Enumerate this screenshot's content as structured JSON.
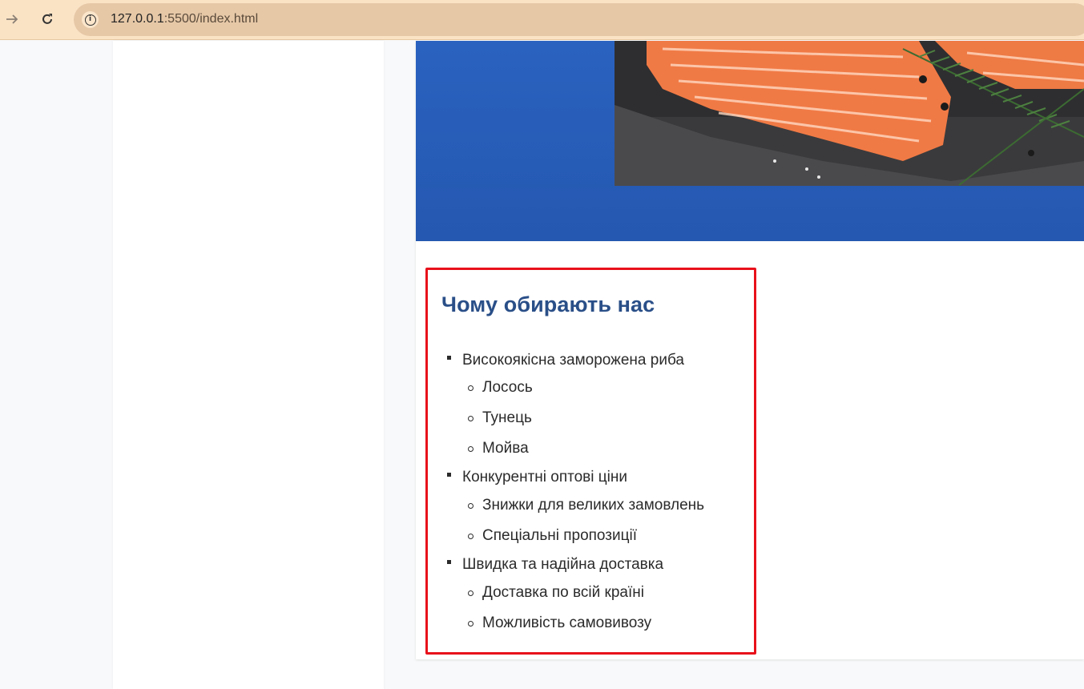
{
  "browser": {
    "url_host": "127.0.0.1",
    "url_rest": ":5500/index.html",
    "forward_icon": "arrow-right-icon",
    "reload_icon": "reload-icon",
    "info_icon": "info-icon"
  },
  "hero": {
    "image": "salmon-fillet-photo"
  },
  "features": {
    "title": "Чому обирають нас",
    "items": [
      {
        "label": "Високоякісна заморожена риба",
        "sub": [
          "Лосось",
          "Тунець",
          "Мойва"
        ]
      },
      {
        "label": "Конкурентні оптові ціни",
        "sub": [
          "Знижки для великих замовлень",
          "Спеціальні пропозиції"
        ]
      },
      {
        "label": "Швидка та надійна доставка",
        "sub": [
          "Доставка по всій країні",
          "Можливість самовивозу"
        ]
      }
    ]
  },
  "colors": {
    "hero_blue": "#2a62c0",
    "title_blue": "#2a4f88",
    "highlight_red": "#e8111b",
    "toolbar_bg": "#fae3c5"
  }
}
